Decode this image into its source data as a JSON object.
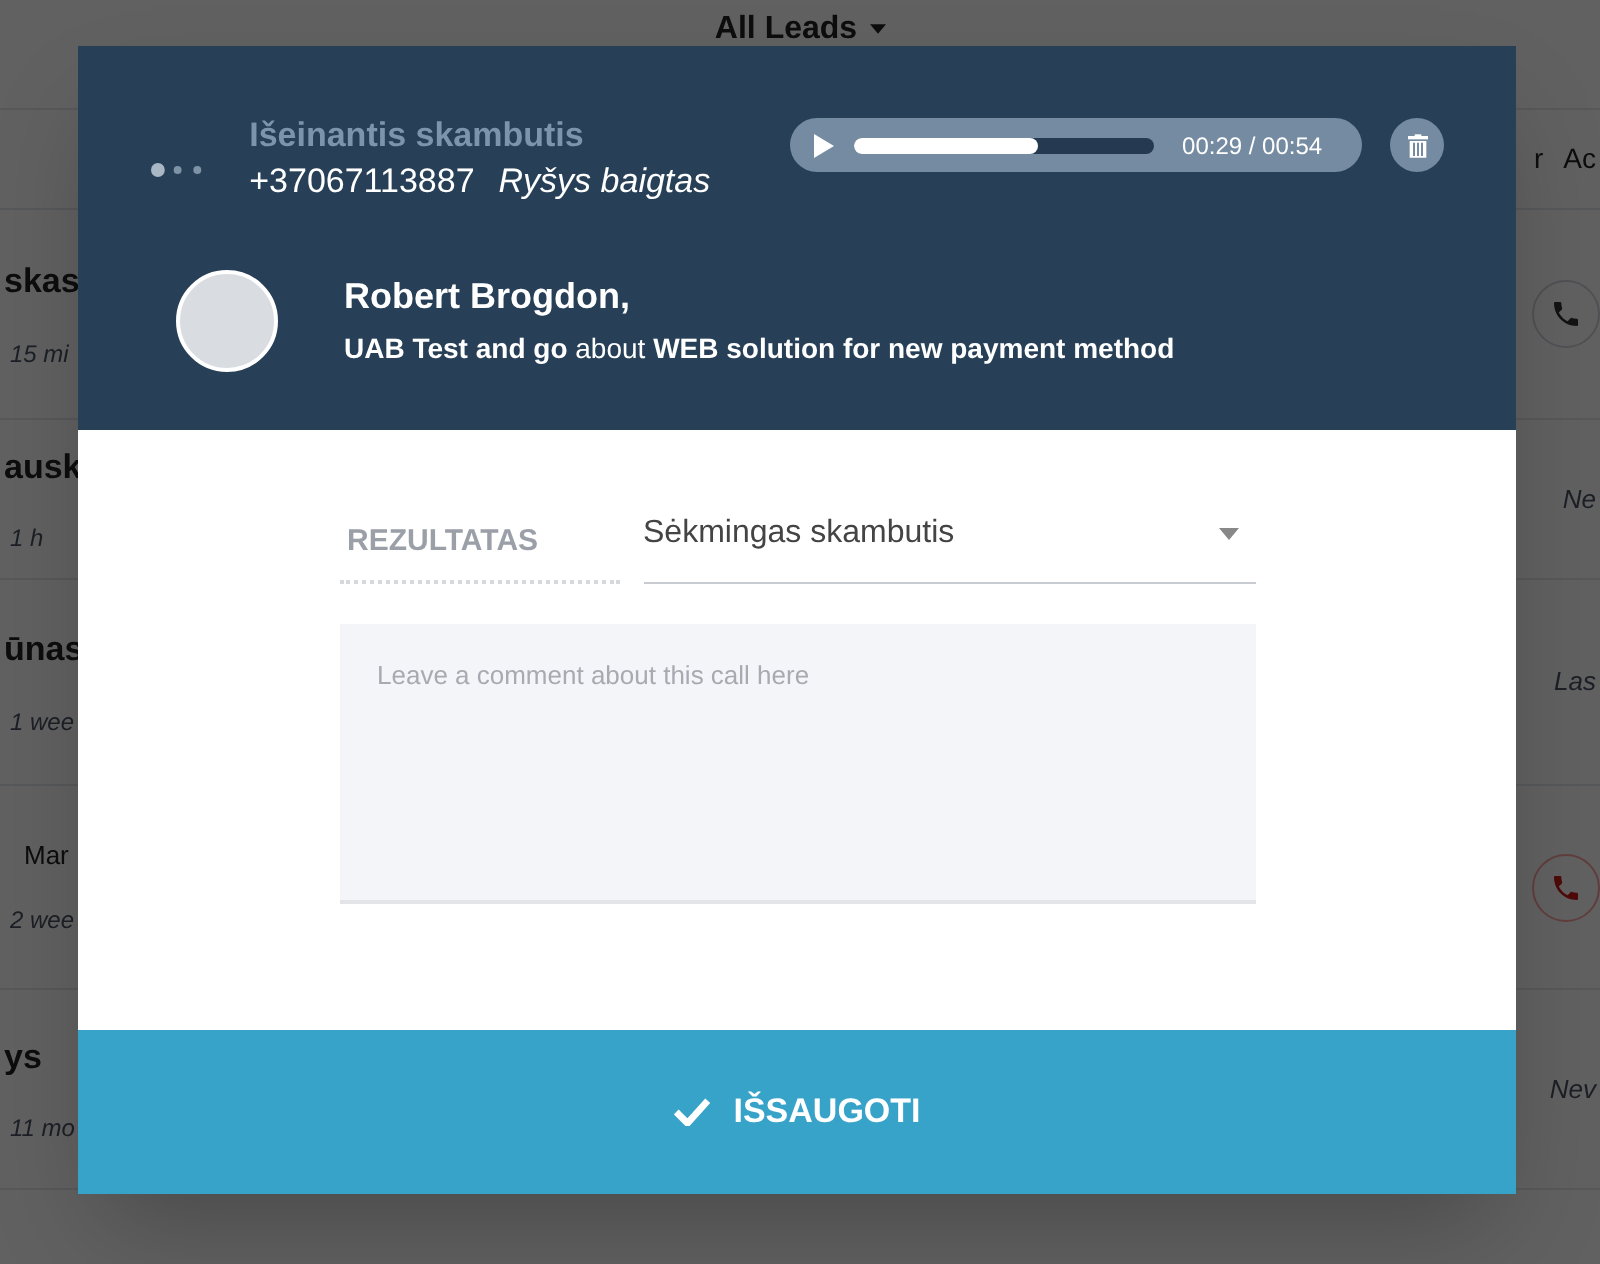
{
  "background": {
    "title": "All Leads",
    "header_right": [
      "r",
      "Ac"
    ],
    "rows": [
      {
        "name": "skas",
        "extra": "",
        "time": "15 mi",
        "right": {
          "kind": "phone",
          "missed": false
        }
      },
      {
        "name": "ausk",
        "extra": "",
        "time": "1 h",
        "right": {
          "kind": "status",
          "text": "Ne"
        }
      },
      {
        "name": "ūnas",
        "extra": "",
        "time": "1 wee",
        "right": {
          "kind": "status",
          "text": "Las"
        }
      },
      {
        "name": "",
        "extra": "Mar",
        "time": "2 wee",
        "right": {
          "kind": "phone",
          "missed": true
        }
      },
      {
        "name": "ys",
        "extra": "",
        "time": "11 mo",
        "right": {
          "kind": "status",
          "text": "Nev"
        }
      }
    ]
  },
  "modal": {
    "call_type": "Išeinantis skambutis",
    "phone": "+37067113887",
    "status": "Ryšys baigtas",
    "player": {
      "level": 0.61,
      "time": "00:29 / 00:54"
    },
    "contact": {
      "name": "Robert Brogdon,",
      "subtitle": "**UAB Test and go** about **WEB solution for new payment method**"
    },
    "result_label": "REZULTATAS",
    "result_value": "Sėkmingas skambutis",
    "comment_placeholder": "Leave a comment about this call here",
    "save_label": "IŠSAUGOTI"
  }
}
